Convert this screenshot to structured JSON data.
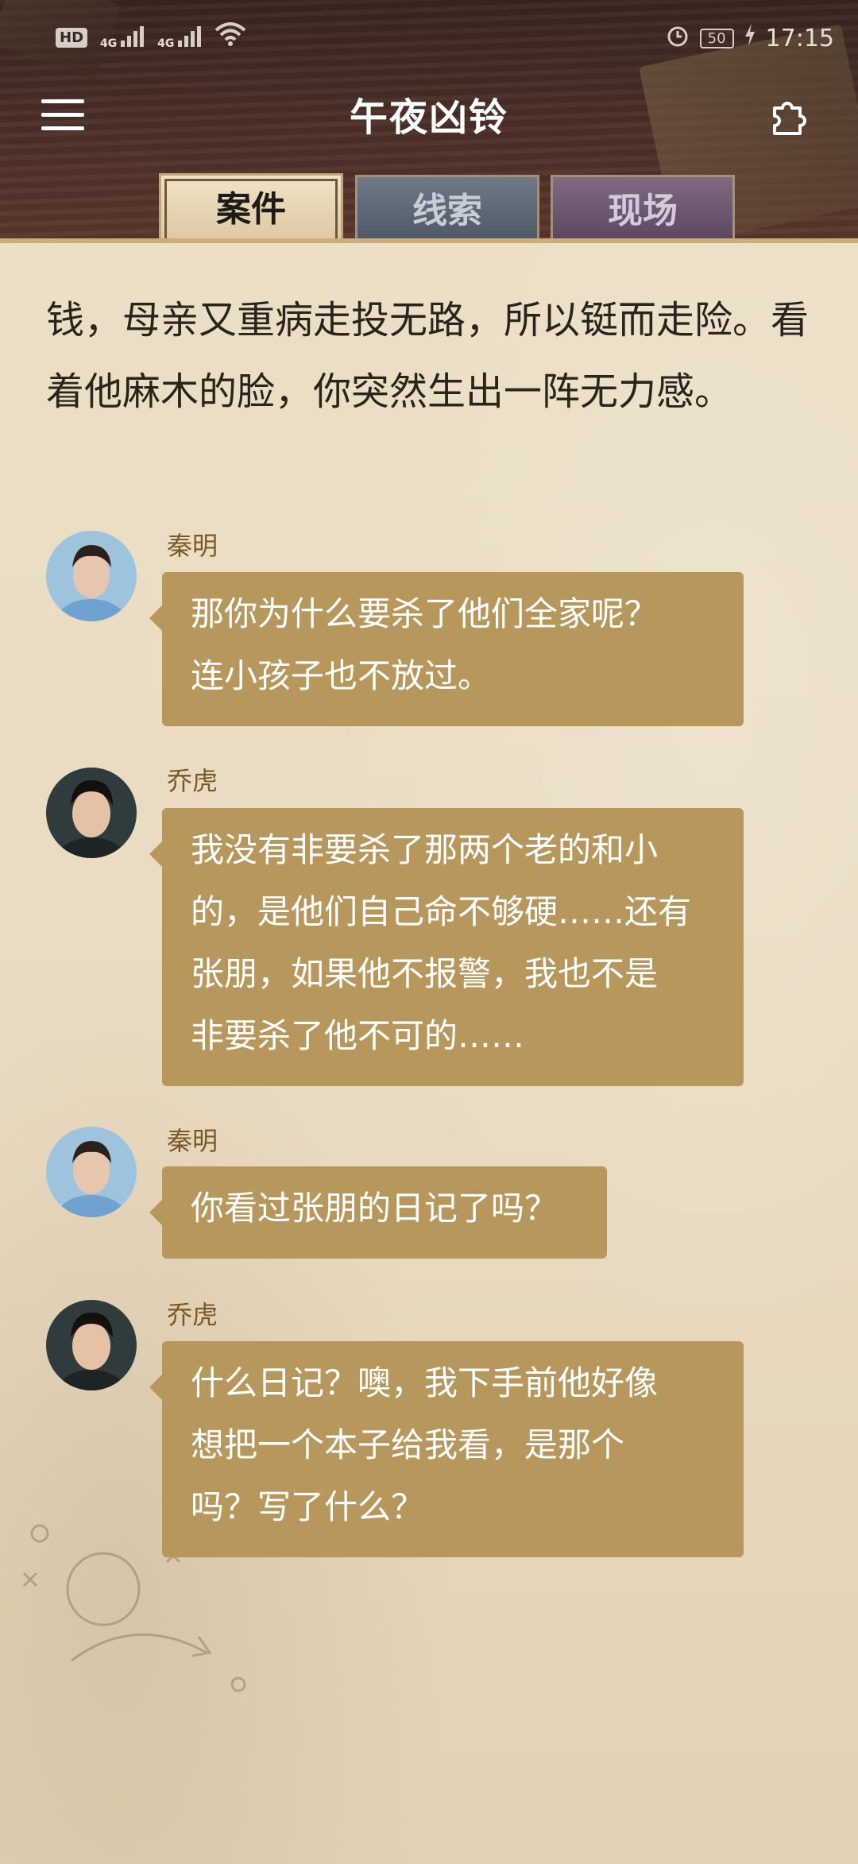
{
  "status_bar": {
    "hd_label": "HD",
    "network_1": "4G",
    "network_2": "4G",
    "battery": "50",
    "time": "17:15"
  },
  "header": {
    "title": "午夜凶铃",
    "menu_icon": "hamburger-icon",
    "puzzle_icon": "puzzle-icon"
  },
  "tabs": [
    {
      "label": "案件",
      "active": true
    },
    {
      "label": "线索",
      "active": false
    },
    {
      "label": "现场",
      "active": false
    }
  ],
  "narration": "钱，母亲又重病走投无路，所以铤而走险。看着他麻木的脸，你突然生出一阵无力感。",
  "messages": [
    {
      "speaker": "秦明",
      "text_lines": [
        "那你为什么要杀了他们全家呢？",
        "连小孩子也不放过。"
      ]
    },
    {
      "speaker": "乔虎",
      "text_lines": [
        "我没有非要杀了那两个老的和小",
        "的，是他们自己命不够硬……还有",
        "张朋，如果他不报警，我也不是",
        "非要杀了他不可的……"
      ]
    },
    {
      "speaker": "秦明",
      "text_lines": [
        "你看过张朋的日记了吗？"
      ]
    },
    {
      "speaker": "乔虎",
      "text_lines": [
        "什么日记？噢，我下手前他好像",
        "想把一个本子给我看，是那个",
        "吗？写了什么？"
      ]
    }
  ],
  "colors": {
    "bubble": "#b8975c",
    "speaker": "#7a5a24",
    "paper": "#e9dcc2",
    "header": "#3a2520"
  }
}
